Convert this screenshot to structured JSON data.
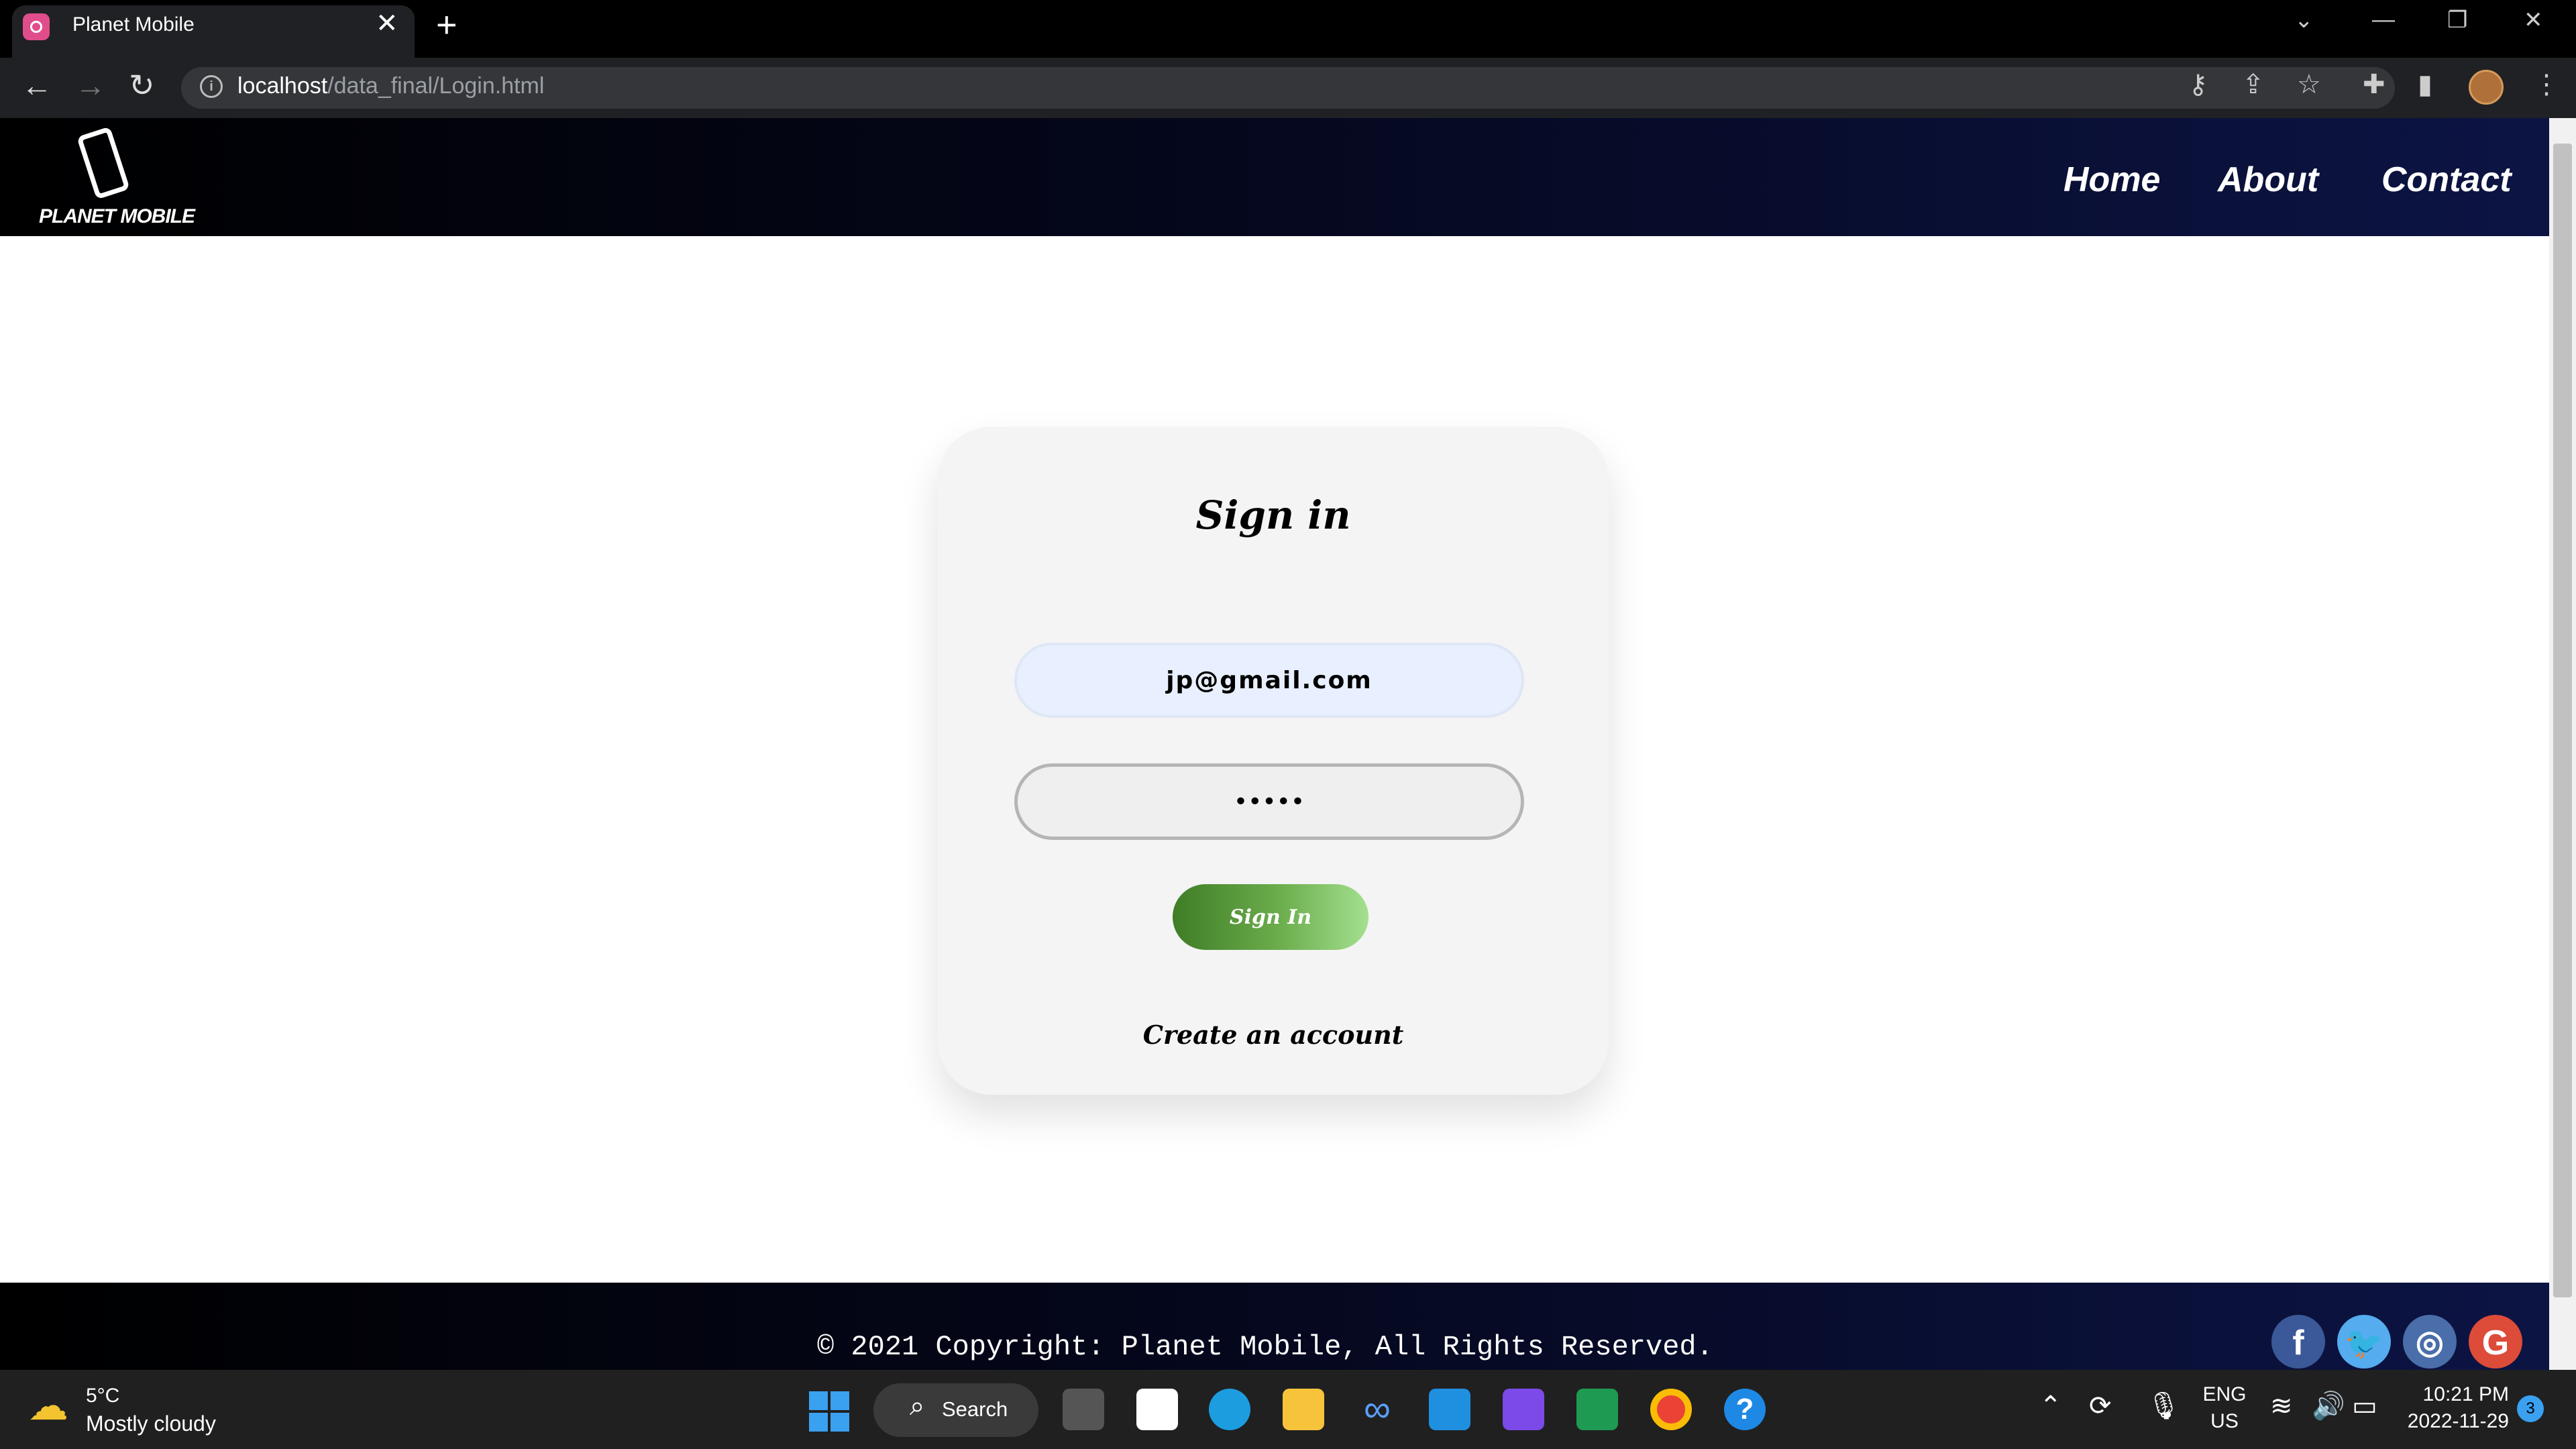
{
  "browser": {
    "tab_title": "Planet Mobile",
    "url_host": "localhost",
    "url_path": "/data_final/Login.html"
  },
  "site": {
    "logo_text": "PLANET MOBILE",
    "nav": {
      "home": "Home",
      "about": "About",
      "contact": "Contact"
    }
  },
  "login": {
    "title": "Sign in",
    "email_value": "jp@gmail.com",
    "password_value": "•••••",
    "signin_label": "Sign In",
    "create_account": "Create an account"
  },
  "footer": {
    "copyright": "© 2021 Copyright: Planet Mobile, All Rights Reserved.",
    "social": [
      {
        "name": "facebook",
        "color": "#3b5998"
      },
      {
        "name": "twitter",
        "color": "#55acee"
      },
      {
        "name": "instagram",
        "color": "#4a6ea9"
      },
      {
        "name": "google",
        "color": "#dd4b39"
      }
    ]
  },
  "taskbar": {
    "weather_temp": "5°C",
    "weather_desc": "Mostly cloudy",
    "search_label": "Search",
    "lang_top": "ENG",
    "lang_bottom": "US",
    "time": "10:21 PM",
    "date": "2022-11-29",
    "notification_count": "3"
  }
}
